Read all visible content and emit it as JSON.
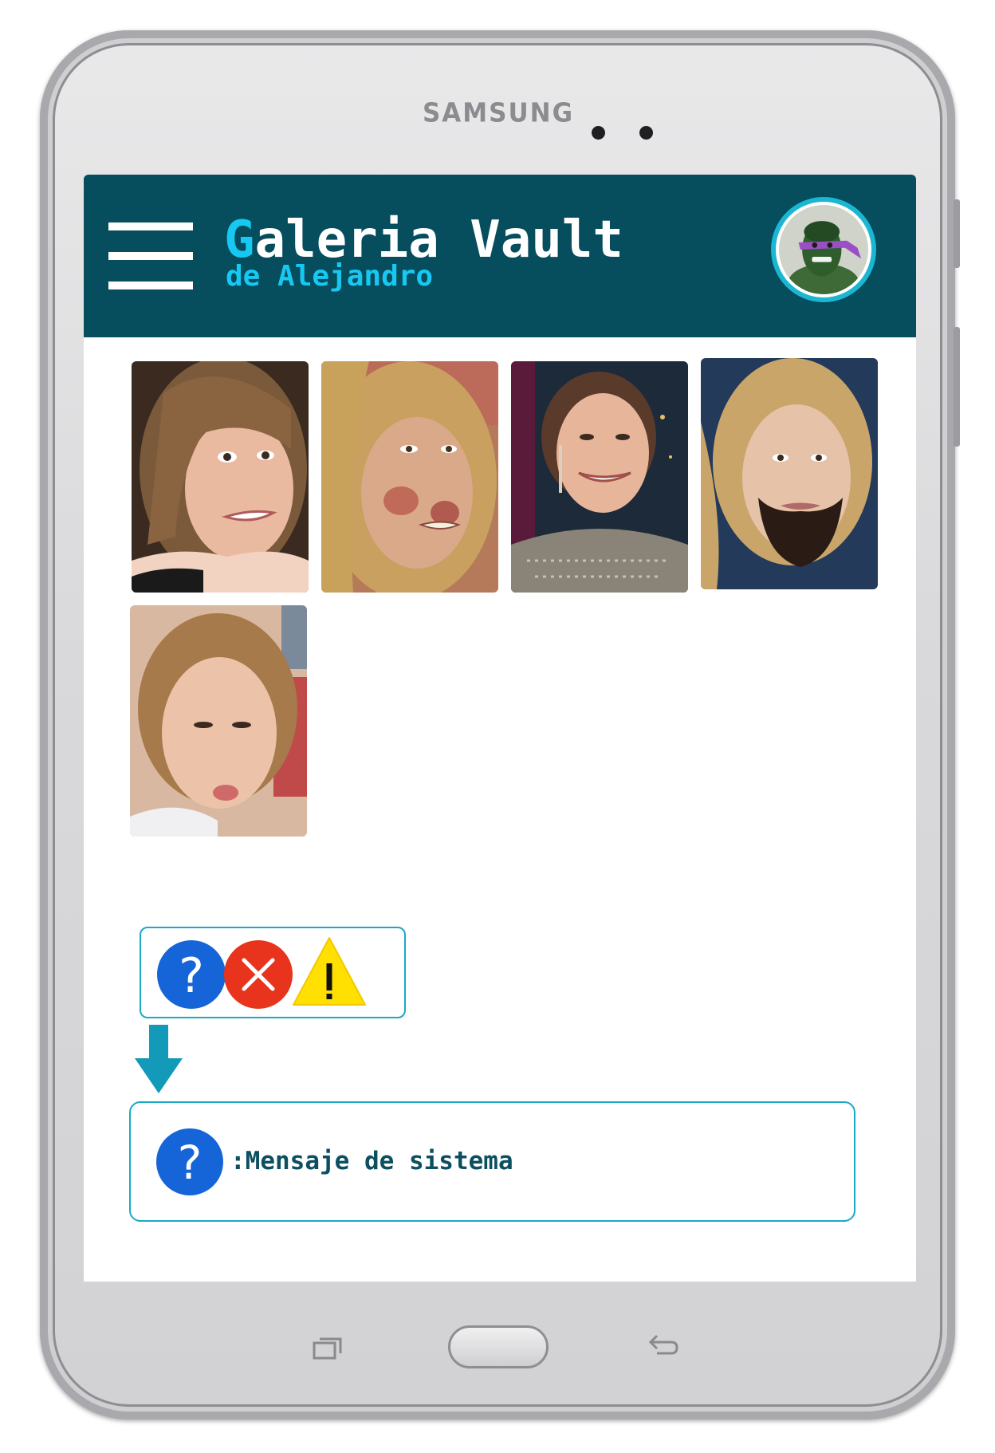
{
  "device": {
    "brand": "SAMSUNG"
  },
  "header": {
    "title_first": "G",
    "title_rest": "aleria Vault",
    "subtitle": "de Alejandro",
    "menu_icon": "hamburger-menu-icon",
    "avatar_icon": "user-avatar"
  },
  "gallery": {
    "items": [
      {
        "name": "gallery-photo-1",
        "icon": "photo"
      },
      {
        "name": "gallery-photo-2",
        "icon": "photo"
      },
      {
        "name": "gallery-photo-3",
        "icon": "photo"
      },
      {
        "name": "gallery-photo-4",
        "icon": "photo"
      },
      {
        "name": "gallery-photo-5",
        "icon": "photo"
      }
    ]
  },
  "status_icons": {
    "question": {
      "glyph": "?",
      "color": "#1565d8"
    },
    "error": {
      "glyph": "✕",
      "color": "#e8341c"
    },
    "warning": {
      "glyph": "!",
      "color": "#ffe000"
    }
  },
  "message": {
    "icon": "question-icon",
    "text": ":Mensaje de sistema"
  },
  "nav": {
    "recent_icon": "recent-apps-icon",
    "home_icon": "home-button",
    "back_icon": "back-icon"
  },
  "colors": {
    "header_bg": "#064d5e",
    "accent": "#17c9f2",
    "border": "#1aa9c6",
    "message_text": "#0c4f60"
  }
}
